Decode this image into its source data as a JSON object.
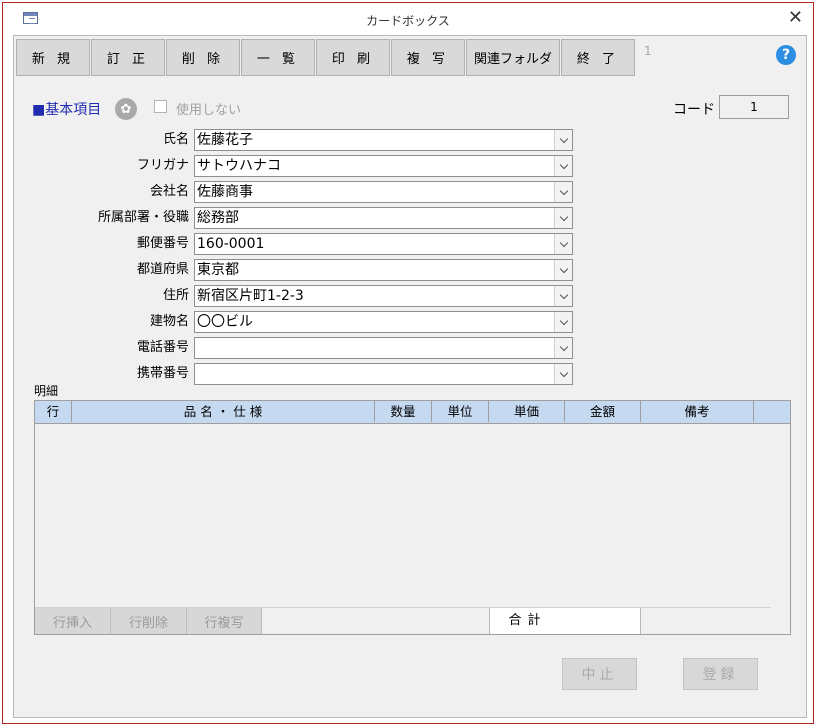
{
  "window": {
    "title": "カードボックス",
    "close_glyph": "✕"
  },
  "toolbar": {
    "buttons": [
      "新 規",
      "訂 正",
      "削 除",
      "一 覧",
      "印 刷",
      "複 写",
      "関連フォルダ",
      "終 了"
    ],
    "page_number": "1",
    "help_glyph": "?"
  },
  "section": {
    "title": "■基本項目",
    "unused_label": "使用しない",
    "code_label": "コード",
    "code_value": "1"
  },
  "fields": [
    {
      "label": "氏名",
      "value": "佐藤花子"
    },
    {
      "label": "フリガナ",
      "value": "サトウハナコ"
    },
    {
      "label": "会社名",
      "value": "佐藤商事"
    },
    {
      "label": "所属部署・役職",
      "value": "総務部"
    },
    {
      "label": "郵便番号",
      "value": "160-0001"
    },
    {
      "label": "都道府県",
      "value": "東京都"
    },
    {
      "label": "住所",
      "value": "新宿区片町1-2-3"
    },
    {
      "label": "建物名",
      "value": "〇〇ビル"
    },
    {
      "label": "電話番号",
      "value": ""
    },
    {
      "label": "携帯番号",
      "value": ""
    }
  ],
  "detail": {
    "title": "明細",
    "columns": [
      "行",
      "品 名 ・ 仕 様",
      "数量",
      "単位",
      "単価",
      "金額",
      "備考"
    ],
    "row_buttons": [
      "行挿入",
      "行削除",
      "行複写"
    ],
    "total_label": "合計",
    "total_value": ""
  },
  "actions": {
    "cancel": "中止",
    "register": "登録"
  },
  "colors": {
    "header_bg": "#c5d9f1",
    "section_title": "#1f2bb0",
    "help_icon": "#2c8ee3",
    "frame_border": "#b3261e"
  }
}
